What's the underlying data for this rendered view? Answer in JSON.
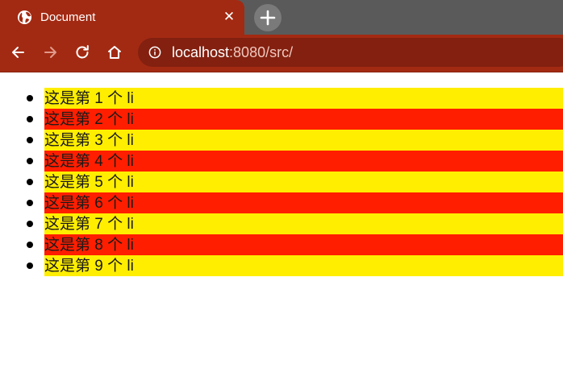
{
  "browser": {
    "tab_title": "Document",
    "close_symbol": "✕",
    "url_host": "localhost",
    "url_rest": ":8080/src/"
  },
  "colors": {
    "odd_item": "#ffee00",
    "even_item": "#ff1e00",
    "chrome": "#a32a12"
  },
  "list": {
    "items": [
      "这是第 1 个 li",
      "这是第 2 个 li",
      "这是第 3 个 li",
      "这是第 4 个 li",
      "这是第 5 个 li",
      "这是第 6 个 li",
      "这是第 7 个 li",
      "这是第 8 个 li",
      "这是第 9 个 li"
    ]
  }
}
